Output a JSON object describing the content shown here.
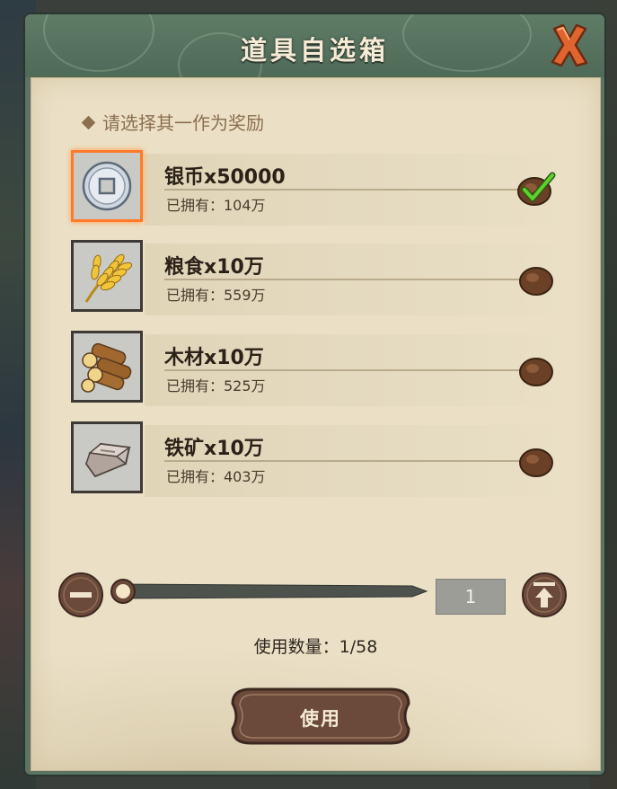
{
  "dialog": {
    "title": "道具自选箱",
    "prompt": "请选择其一作为奖励",
    "close_icon": "close-x-icon"
  },
  "items": [
    {
      "name": "银币x50000",
      "owned": "已拥有：104万",
      "icon": "silver-coin-icon",
      "selected": true
    },
    {
      "name": "粮食x10万",
      "owned": "已拥有：559万",
      "icon": "wheat-icon",
      "selected": false
    },
    {
      "name": "木材x10万",
      "owned": "已拥有：525万",
      "icon": "wood-logs-icon",
      "selected": false
    },
    {
      "name": "铁矿x10万",
      "owned": "已拥有：403万",
      "icon": "iron-ingot-icon",
      "selected": false
    }
  ],
  "quantity": {
    "value": "1",
    "usage_text": "使用数量：1/58",
    "slider_fraction": 0
  },
  "use_button": {
    "label": "使用"
  },
  "colors": {
    "header_green": "#5f7c67",
    "panel_beige": "#ebe0c6",
    "button_brown": "#6b4a3a",
    "selected_border": "#ff7a2a",
    "check_green": "#4fbf2a"
  }
}
